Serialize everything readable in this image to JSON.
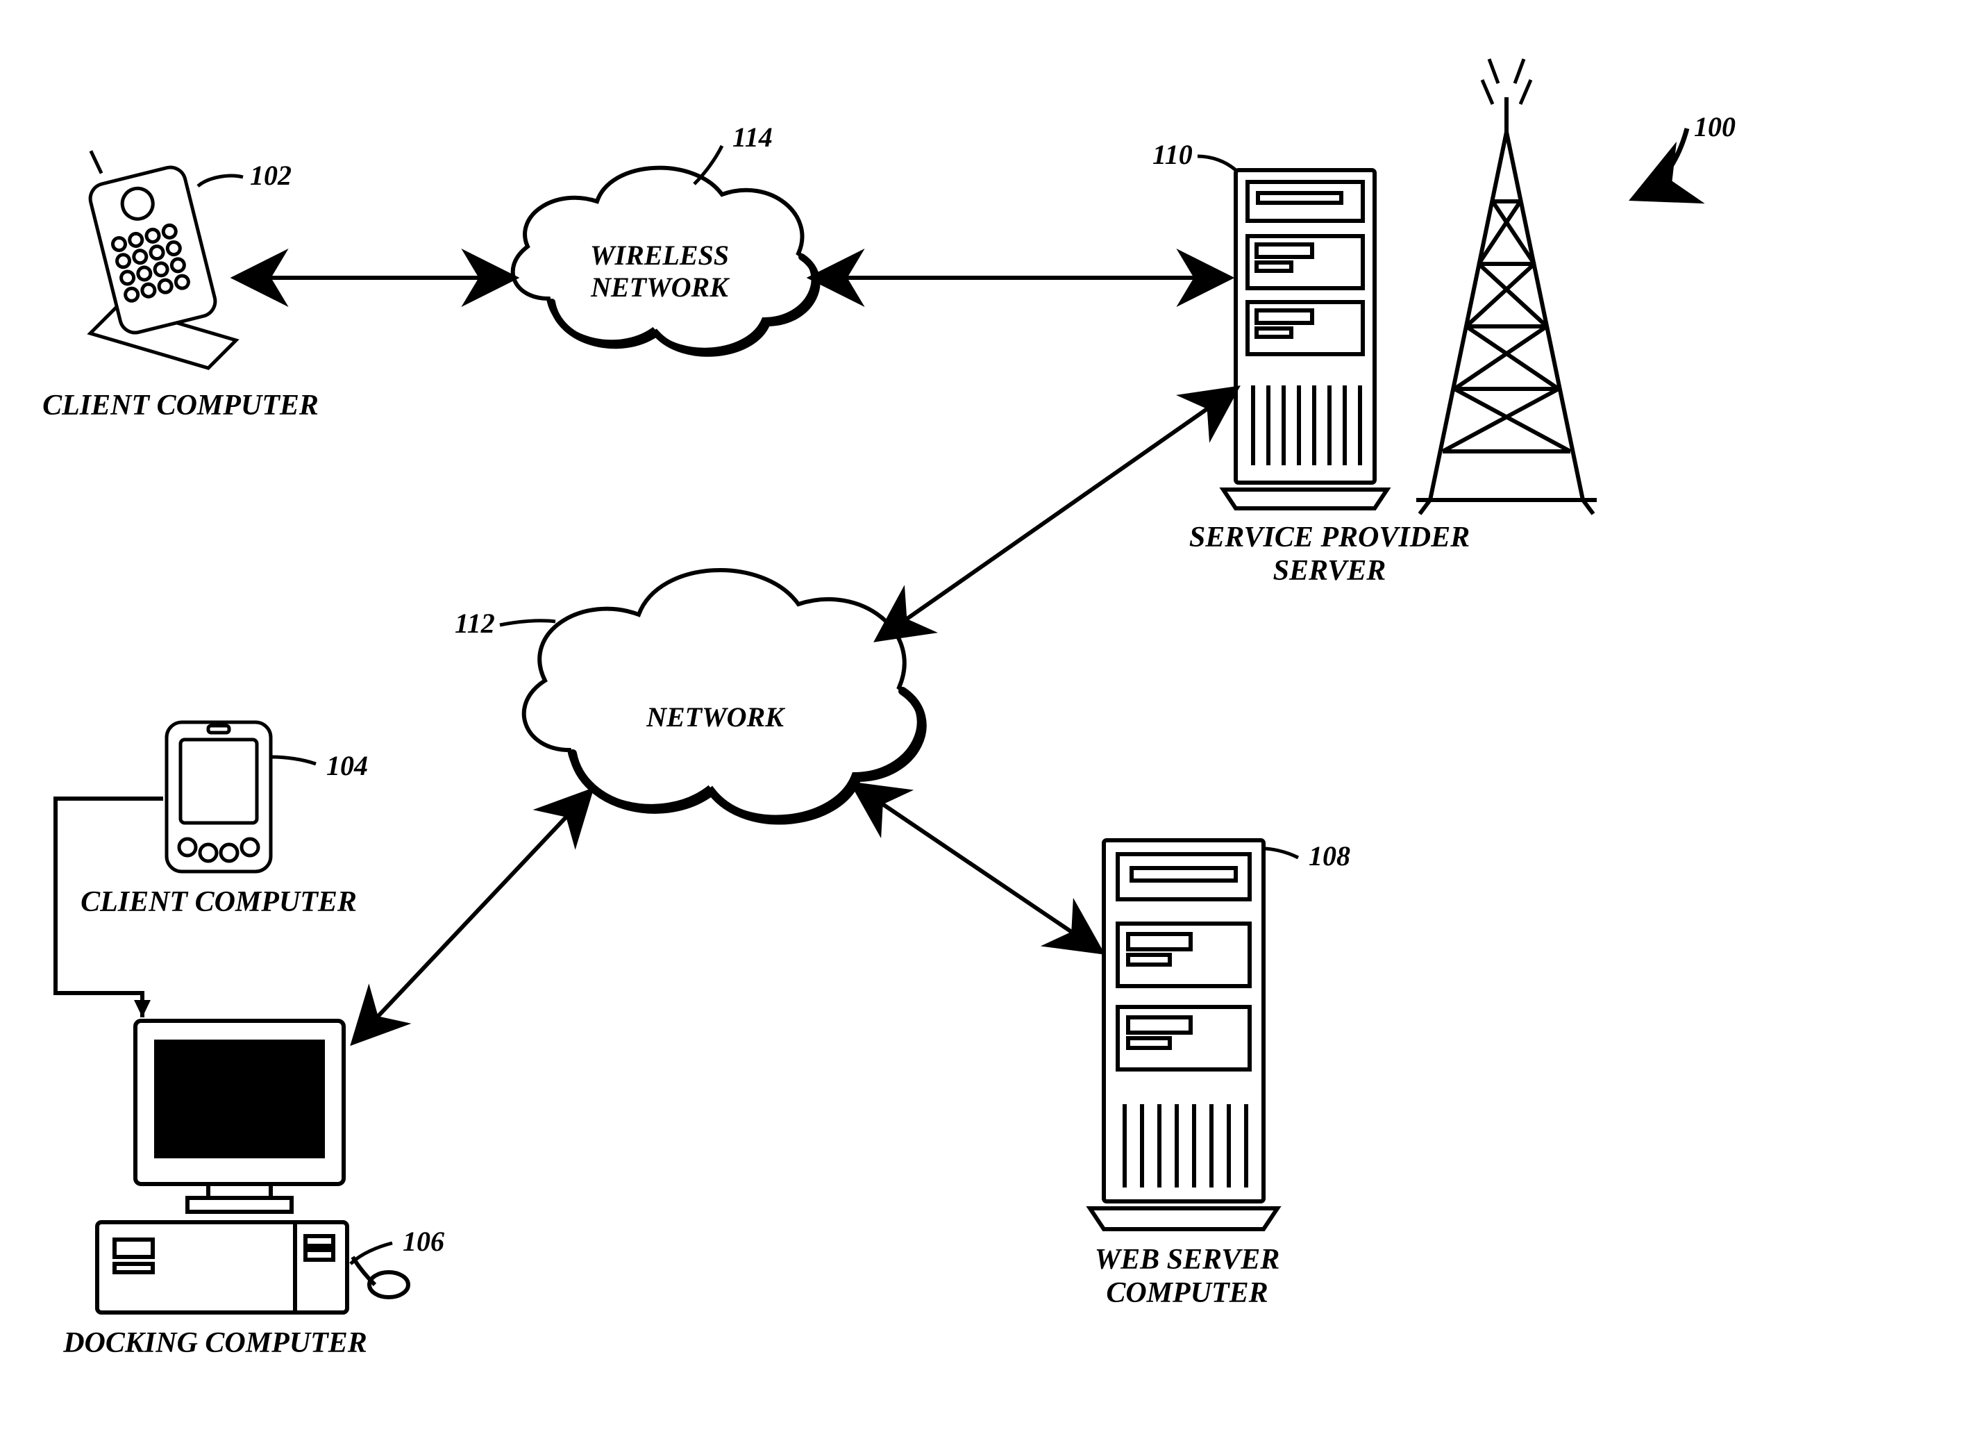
{
  "figure_ref": "100",
  "nodes": {
    "client_phone": {
      "ref": "102",
      "caption": "CLIENT COMPUTER"
    },
    "client_pda": {
      "ref": "104",
      "caption": "CLIENT COMPUTER"
    },
    "docking": {
      "ref": "106",
      "caption": "DOCKING COMPUTER"
    },
    "web_server": {
      "ref": "108",
      "caption": "WEB SERVER\nCOMPUTER"
    },
    "sp_server": {
      "ref": "110",
      "caption": "SERVICE PROVIDER\nSERVER"
    },
    "network": {
      "ref": "112",
      "caption": "NETWORK"
    },
    "wireless": {
      "ref": "114",
      "caption": "WIRELESS\nNETWORK"
    }
  }
}
